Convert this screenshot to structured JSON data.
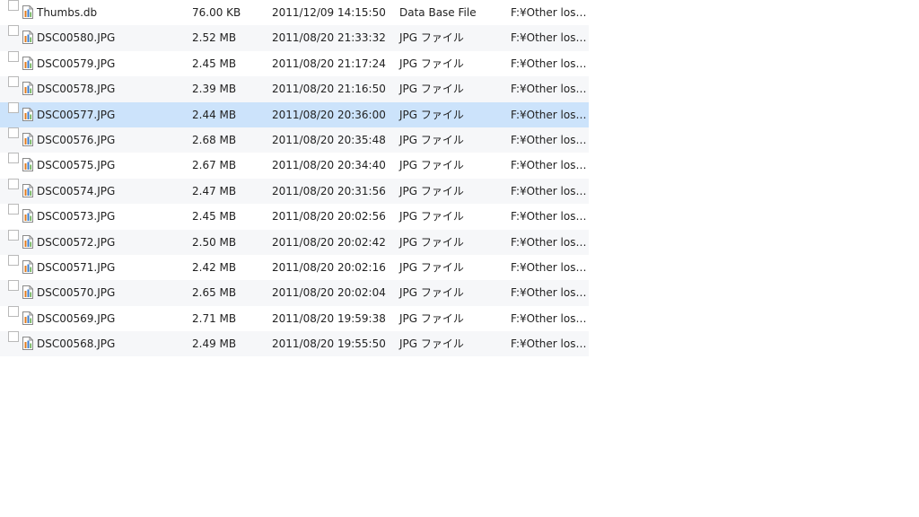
{
  "files": [
    {
      "name": "Thumbs.db",
      "size": "76.00 KB",
      "date": "2011/12/09 14:15:50",
      "type": "Data Base File",
      "path": "F:¥Other los…",
      "selected": false
    },
    {
      "name": "DSC00580.JPG",
      "size": "2.52 MB",
      "date": "2011/08/20 21:33:32",
      "type": "JPG ファイル",
      "path": "F:¥Other los…",
      "selected": false
    },
    {
      "name": "DSC00579.JPG",
      "size": "2.45 MB",
      "date": "2011/08/20 21:17:24",
      "type": "JPG ファイル",
      "path": "F:¥Other los…",
      "selected": false
    },
    {
      "name": "DSC00578.JPG",
      "size": "2.39 MB",
      "date": "2011/08/20 21:16:50",
      "type": "JPG ファイル",
      "path": "F:¥Other los…",
      "selected": false
    },
    {
      "name": "DSC00577.JPG",
      "size": "2.44 MB",
      "date": "2011/08/20 20:36:00",
      "type": "JPG ファイル",
      "path": "F:¥Other los…",
      "selected": true
    },
    {
      "name": "DSC00576.JPG",
      "size": "2.68 MB",
      "date": "2011/08/20 20:35:48",
      "type": "JPG ファイル",
      "path": "F:¥Other los…",
      "selected": false
    },
    {
      "name": "DSC00575.JPG",
      "size": "2.67 MB",
      "date": "2011/08/20 20:34:40",
      "type": "JPG ファイル",
      "path": "F:¥Other los…",
      "selected": false
    },
    {
      "name": "DSC00574.JPG",
      "size": "2.47 MB",
      "date": "2011/08/20 20:31:56",
      "type": "JPG ファイル",
      "path": "F:¥Other los…",
      "selected": false
    },
    {
      "name": "DSC00573.JPG",
      "size": "2.45 MB",
      "date": "2011/08/20 20:02:56",
      "type": "JPG ファイル",
      "path": "F:¥Other los…",
      "selected": false
    },
    {
      "name": "DSC00572.JPG",
      "size": "2.50 MB",
      "date": "2011/08/20 20:02:42",
      "type": "JPG ファイル",
      "path": "F:¥Other los…",
      "selected": false
    },
    {
      "name": "DSC00571.JPG",
      "size": "2.42 MB",
      "date": "2011/08/20 20:02:16",
      "type": "JPG ファイル",
      "path": "F:¥Other los…",
      "selected": false
    },
    {
      "name": "DSC00570.JPG",
      "size": "2.65 MB",
      "date": "2011/08/20 20:02:04",
      "type": "JPG ファイル",
      "path": "F:¥Other los…",
      "selected": false
    },
    {
      "name": "DSC00569.JPG",
      "size": "2.71 MB",
      "date": "2011/08/20 19:59:38",
      "type": "JPG ファイル",
      "path": "F:¥Other los…",
      "selected": false
    },
    {
      "name": "DSC00568.JPG",
      "size": "2.49 MB",
      "date": "2011/08/20 19:55:50",
      "type": "JPG ファイル",
      "path": "F:¥Other los…",
      "selected": false
    }
  ],
  "icons": {
    "row_icon": "file-icon"
  },
  "colors": {
    "selected_row": "#cce3fb",
    "alternate_row": "#f6f7f9"
  }
}
